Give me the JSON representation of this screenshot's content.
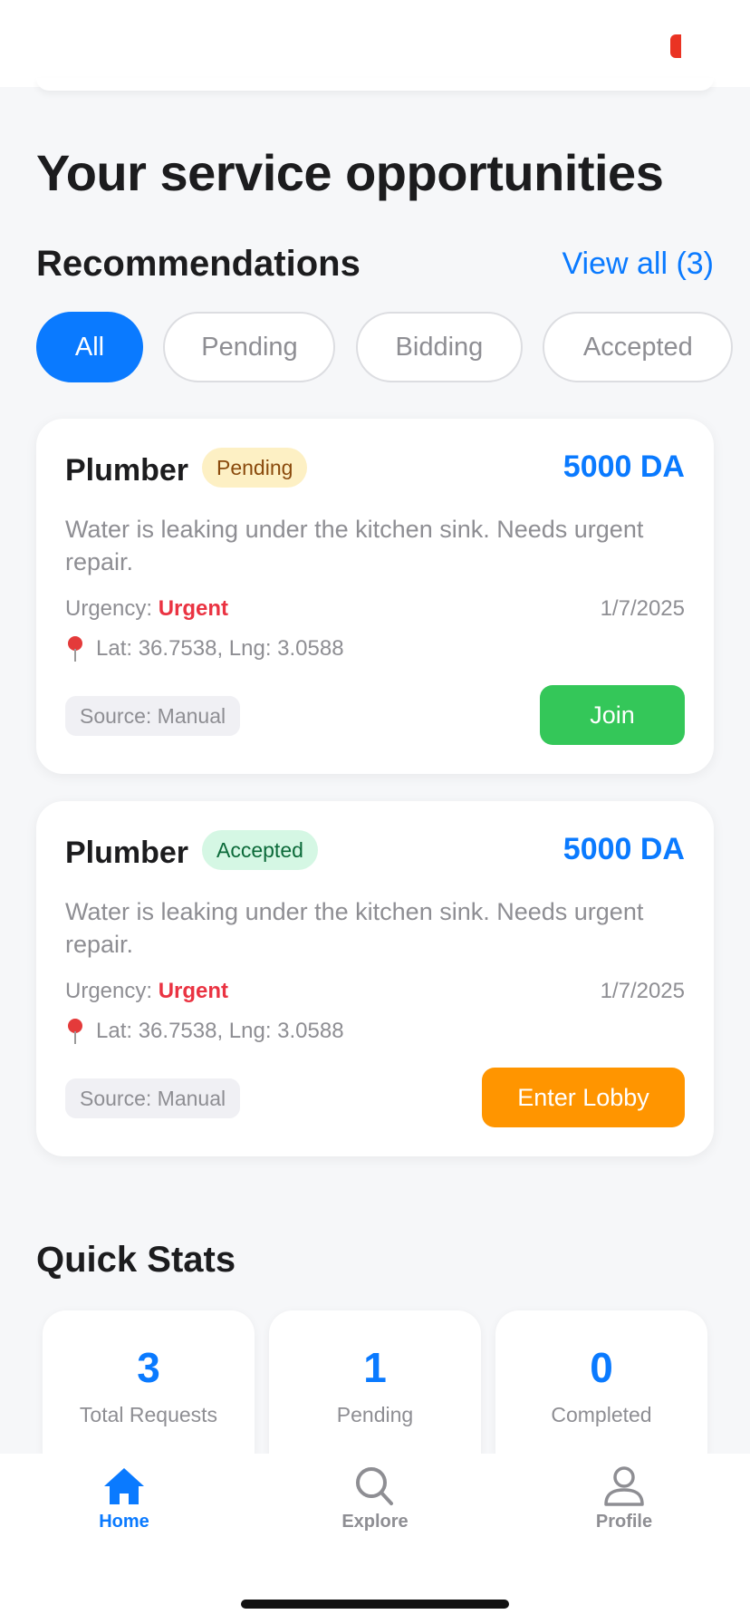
{
  "page": {
    "title": "Your service opportunities"
  },
  "recommendations": {
    "heading": "Recommendations",
    "view_all": "View all (3)"
  },
  "filters": [
    {
      "label": "All",
      "active": true
    },
    {
      "label": "Pending",
      "active": false
    },
    {
      "label": "Bidding",
      "active": false
    },
    {
      "label": "Accepted",
      "active": false
    }
  ],
  "cards": [
    {
      "title": "Plumber",
      "status": "Pending",
      "price": "5000 DA",
      "description": "Water is leaking under the kitchen sink. Needs urgent repair.",
      "urgency_label": "Urgency:",
      "urgency_value": "Urgent",
      "date": "1/7/2025",
      "location": "Lat: 36.7538, Lng: 3.0588",
      "source": "Source: Manual",
      "action": "Join"
    },
    {
      "title": "Plumber",
      "status": "Accepted",
      "price": "5000 DA",
      "description": "Water is leaking under the kitchen sink. Needs urgent repair.",
      "urgency_label": "Urgency:",
      "urgency_value": "Urgent",
      "date": "1/7/2025",
      "location": "Lat: 36.7538, Lng: 3.0588",
      "source": "Source: Manual",
      "action": "Enter Lobby"
    }
  ],
  "stats": {
    "heading": "Quick Stats",
    "items": [
      {
        "value": "3",
        "label": "Total Requests"
      },
      {
        "value": "1",
        "label": "Pending"
      },
      {
        "value": "0",
        "label": "Completed"
      }
    ]
  },
  "tabbar": {
    "items": [
      {
        "label": "Home",
        "icon": "house-icon",
        "active": true
      },
      {
        "label": "Explore",
        "icon": "search-icon",
        "active": false
      },
      {
        "label": "Profile",
        "icon": "person-icon",
        "active": false
      }
    ]
  },
  "colors": {
    "accent": "#0a7aff",
    "join": "#34c759",
    "lobby": "#ff9500",
    "urgent": "#ea3342"
  }
}
